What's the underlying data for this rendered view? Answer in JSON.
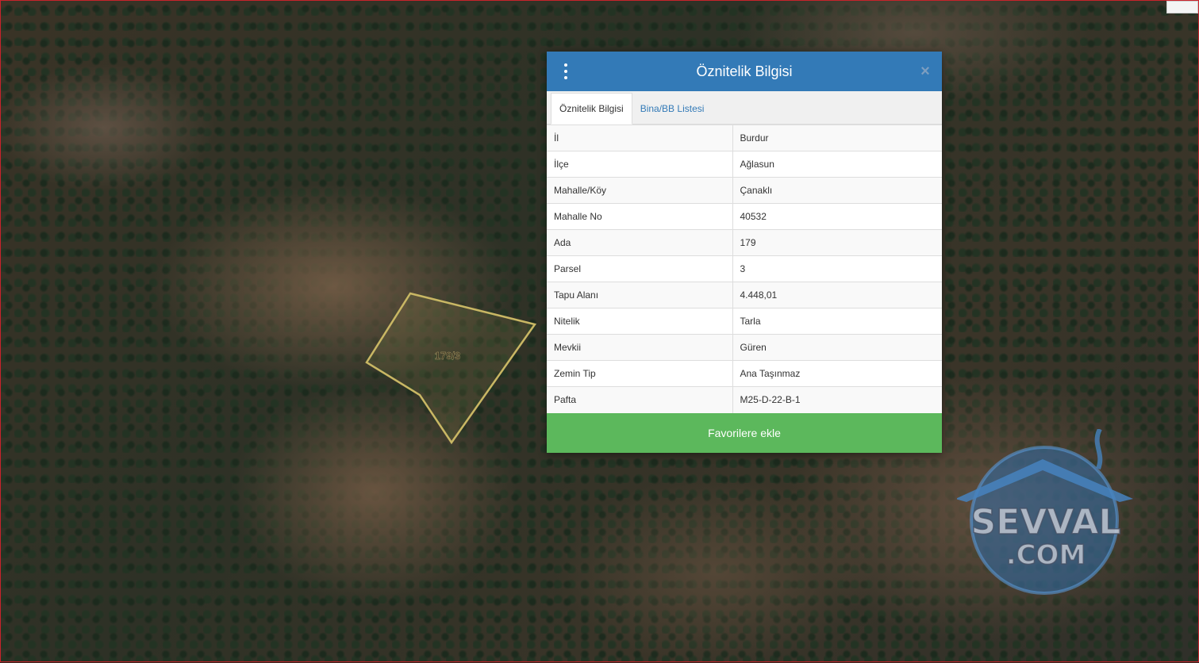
{
  "map": {
    "parcel_label": "179/3",
    "parcel_color": "#c9b764",
    "watermark": {
      "line1": "SEVVAL",
      "line2": ".COM"
    }
  },
  "panel": {
    "title": "Öznitelik Bilgisi",
    "close_symbol": "×",
    "header_color": "#337ab7",
    "tabs": [
      {
        "label": "Öznitelik Bilgisi",
        "active": true
      },
      {
        "label": "Bina/BB Listesi",
        "active": false
      }
    ],
    "rows": [
      {
        "key": "İl",
        "value": "Burdur"
      },
      {
        "key": "İlçe",
        "value": "Ağlasun"
      },
      {
        "key": "Mahalle/Köy",
        "value": "Çanaklı"
      },
      {
        "key": "Mahalle No",
        "value": "40532"
      },
      {
        "key": "Ada",
        "value": "179"
      },
      {
        "key": "Parsel",
        "value": "3"
      },
      {
        "key": "Tapu Alanı",
        "value": "4.448,01"
      },
      {
        "key": "Nitelik",
        "value": "Tarla"
      },
      {
        "key": "Mevkii",
        "value": "Güren"
      },
      {
        "key": "Zemin Tip",
        "value": "Ana Taşınmaz"
      },
      {
        "key": "Pafta",
        "value": "M25-D-22-B-1"
      }
    ],
    "favorite_button": "Favorilere ekle",
    "favorite_color": "#5cb85c"
  }
}
